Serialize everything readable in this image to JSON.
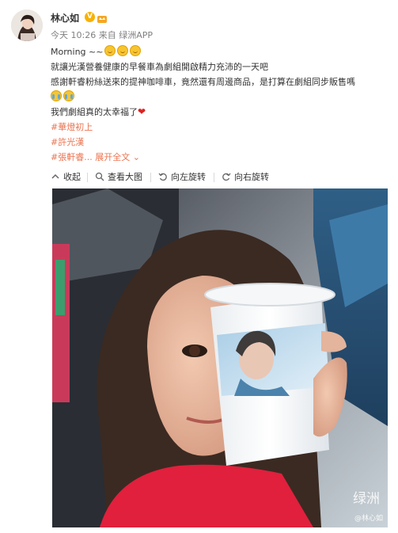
{
  "user": {
    "name": "林心如",
    "verified_badge": "V",
    "avatar_icon": "avatar-icon",
    "crown_icon": "crown-badge-icon"
  },
  "meta": {
    "time": "今天 10:26",
    "from_label": "来自",
    "source": "绿洲APP"
  },
  "content": {
    "line1_text": "Morning ~~",
    "line2": "就讓光漢營養健康的早餐車為劇組開啟精力充沛的一天吧",
    "line3": "感謝軒睿粉絲送來的提神咖啡車，竟然還有周邊商品，是打算在劇組同步販售嗎",
    "line5_text": "我們劇組真的太幸福了",
    "tag1": "#華燈初上",
    "tag2": "#許光漢",
    "tag3": "#張軒睿...",
    "expand": "展开全文",
    "expand_icon": "chevron-down-icon"
  },
  "toolbar": {
    "collapse": "收起",
    "view_large": "查看大图",
    "rotate_left": "向左旋转",
    "rotate_right": "向右旋转"
  },
  "photo": {
    "watermark": "绿洲",
    "watermark_user": "@林心如"
  },
  "colors": {
    "link": "#eb7350",
    "meta": "#808080",
    "text": "#333333",
    "heart": "#e02020"
  }
}
